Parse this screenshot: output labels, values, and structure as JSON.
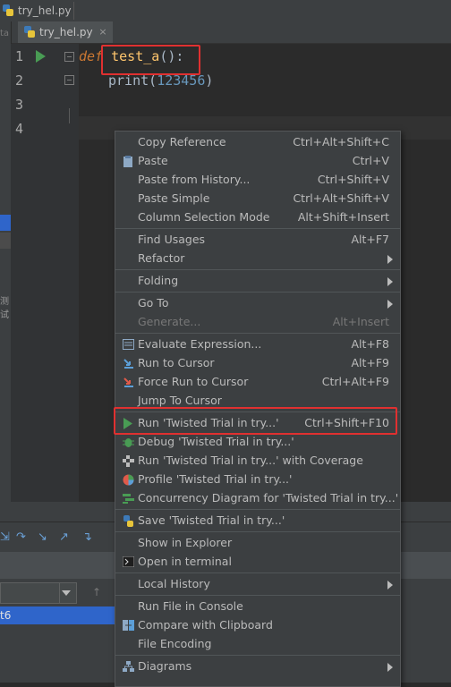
{
  "window": {
    "file_title": "try_hel.py"
  },
  "editor_tab": {
    "label": "try_hel.py",
    "close": "×"
  },
  "left_strip": {
    "glyph_top": "ta",
    "glyph_mid": "测试"
  },
  "gutter": {
    "line_numbers": [
      "1",
      "2",
      "3",
      "4"
    ]
  },
  "code": {
    "line1_keyword": "def",
    "line1_func": "test_a",
    "line1_rest": "():",
    "line2_builtin": "print",
    "line2_open": "(",
    "line2_num": "123456",
    "line2_close": ")"
  },
  "bottom_panel": {
    "selected_row_text": "t6"
  },
  "context_menu": {
    "items": [
      {
        "label": "Copy Reference",
        "shortcut": "Ctrl+Alt+Shift+C"
      },
      {
        "label": "Paste",
        "shortcut": "Ctrl+V",
        "icon": "paste-icon"
      },
      {
        "label": "Paste from History...",
        "shortcut": "Ctrl+Shift+V"
      },
      {
        "label": "Paste Simple",
        "shortcut": "Ctrl+Alt+Shift+V"
      },
      {
        "label": "Column Selection Mode",
        "shortcut": "Alt+Shift+Insert"
      },
      {
        "label": "Find Usages",
        "shortcut": "Alt+F7"
      },
      {
        "label": "Refactor",
        "shortcut": ""
      },
      {
        "label": "Folding",
        "shortcut": ""
      },
      {
        "label": "Go To",
        "shortcut": ""
      },
      {
        "label": "Generate...",
        "shortcut": "Alt+Insert",
        "disabled": true
      },
      {
        "label": "Evaluate Expression...",
        "shortcut": "Alt+F8",
        "icon": "evaluate-icon"
      },
      {
        "label": "Run to Cursor",
        "shortcut": "Alt+F9",
        "icon": "run-to-cursor-icon"
      },
      {
        "label": "Force Run to Cursor",
        "shortcut": "Ctrl+Alt+F9",
        "icon": "force-run-icon"
      },
      {
        "label": "Jump To Cursor",
        "shortcut": ""
      },
      {
        "label": "Run 'Twisted Trial in try...'",
        "shortcut": "Ctrl+Shift+F10",
        "icon": "run-icon"
      },
      {
        "label": "Debug 'Twisted Trial in try...'",
        "shortcut": "",
        "icon": "debug-icon"
      },
      {
        "label": "Run 'Twisted Trial in try...' with Coverage",
        "shortcut": "",
        "icon": "coverage-icon"
      },
      {
        "label": "Profile 'Twisted Trial in try...'",
        "shortcut": "",
        "icon": "profile-icon"
      },
      {
        "label": "Concurrency Diagram for 'Twisted Trial in try...'",
        "shortcut": "",
        "icon": "concurrency-icon"
      },
      {
        "label": "Save 'Twisted Trial in try...'",
        "shortcut": "",
        "icon": "python-icon"
      },
      {
        "label": "Show in Explorer",
        "shortcut": ""
      },
      {
        "label": "Open in terminal",
        "shortcut": "",
        "icon": "terminal-icon"
      },
      {
        "label": "Local History",
        "shortcut": ""
      },
      {
        "label": "Run File in Console",
        "shortcut": ""
      },
      {
        "label": "Compare with Clipboard",
        "shortcut": "",
        "icon": "compare-icon"
      },
      {
        "label": "File Encoding",
        "shortcut": ""
      },
      {
        "label": "Diagrams",
        "shortcut": "",
        "icon": "diagrams-icon"
      }
    ]
  },
  "colors": {
    "highlight_box": "#e03030",
    "run_green": "#499c54",
    "selection_blue": "#2f65ca"
  }
}
